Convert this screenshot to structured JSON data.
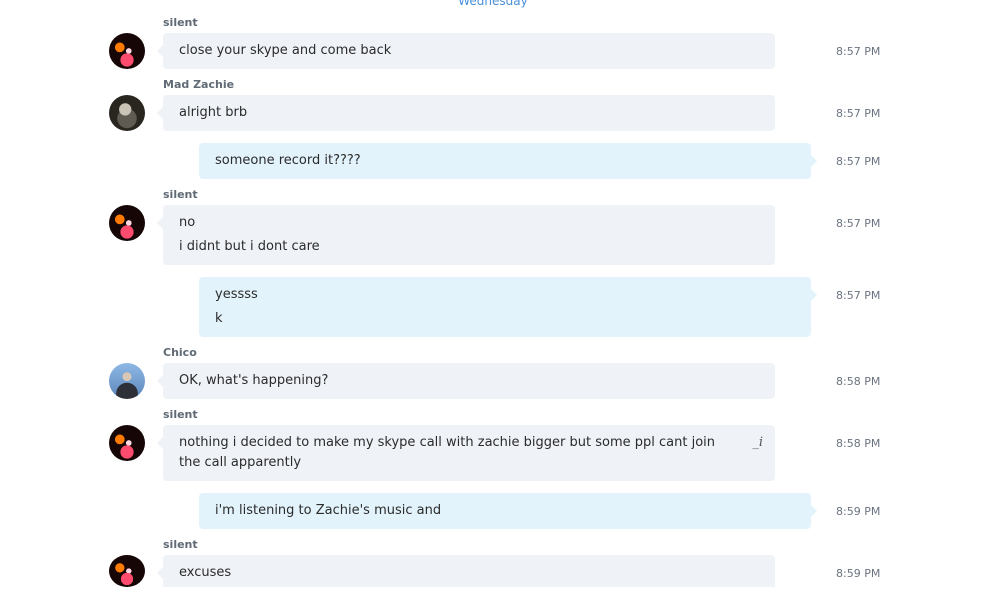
{
  "day_divider": "Wednesday",
  "messages": [
    {
      "sender": "silent",
      "lines": [
        "close your skype and come back"
      ],
      "time": "8:57 PM"
    },
    {
      "sender": "Mad Zachie",
      "lines": [
        "alright brb"
      ],
      "time": "8:57 PM"
    },
    {
      "lines": [
        "someone record it????"
      ],
      "time": "8:57 PM"
    },
    {
      "sender": "silent",
      "lines": [
        "no",
        "i didnt but i dont care"
      ],
      "time": "8:57 PM"
    },
    {
      "lines": [
        "yessss",
        "k"
      ],
      "time": "8:57 PM"
    },
    {
      "sender": "Chico",
      "lines": [
        "OK, what's happening?"
      ],
      "time": "8:58 PM"
    },
    {
      "sender": "silent",
      "lines": [
        "nothing i decided to make my skype call with zachie bigger but  some ppl cant join the call apparently"
      ],
      "time": "8:58 PM",
      "edit_icon": "_i"
    },
    {
      "lines": [
        "i'm listening to Zachie's music and"
      ],
      "time": "8:59 PM"
    },
    {
      "sender": "silent",
      "lines": [
        "excuses"
      ],
      "time": "8:59 PM"
    }
  ]
}
